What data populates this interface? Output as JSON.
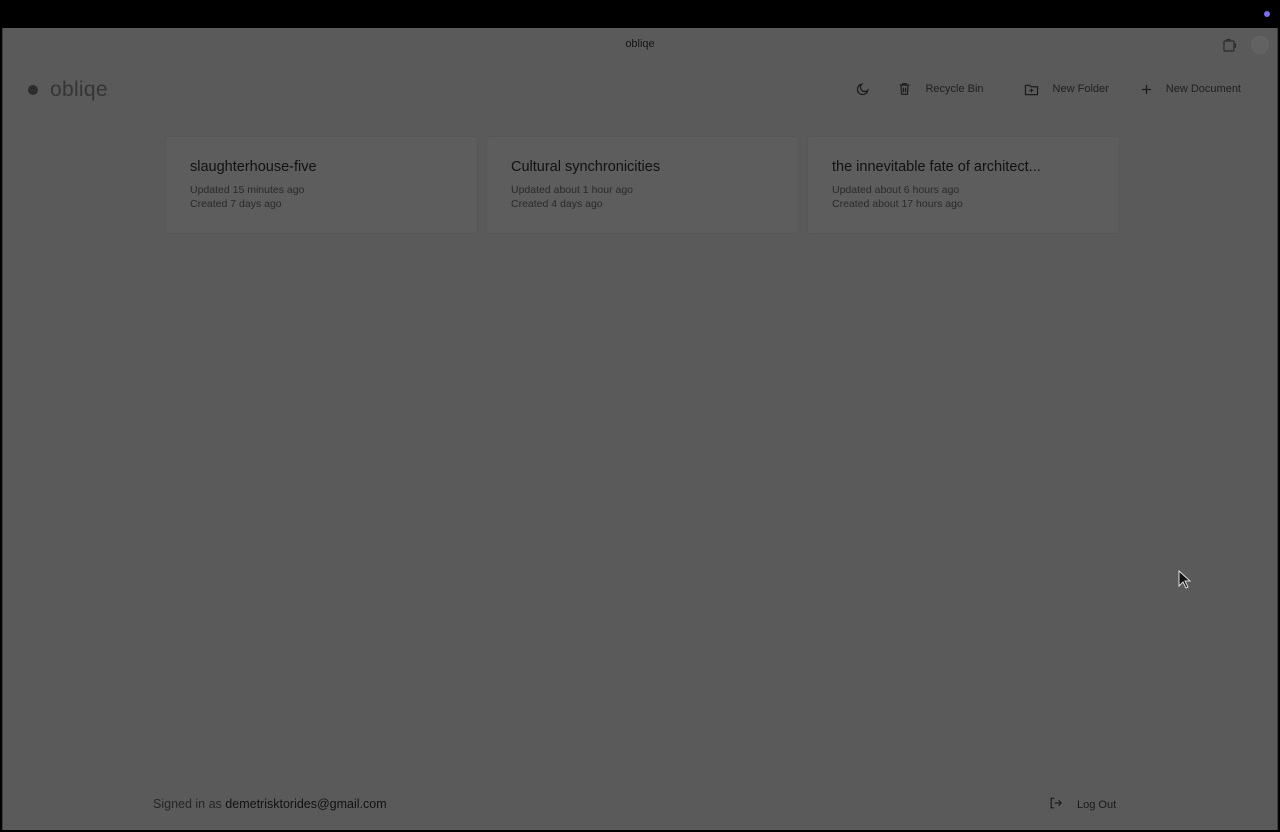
{
  "window": {
    "title": "obliqe"
  },
  "header": {
    "logo_text": "obliqe",
    "actions": {
      "theme_toggle_icon": "moon-icon",
      "recycle_bin_label": "Recycle Bin",
      "new_folder_label": "New Folder",
      "new_document_label": "New Document"
    }
  },
  "documents": [
    {
      "title": "slaughterhouse-five",
      "updated": "Updated 15 minutes ago",
      "created": "Created 7 days ago"
    },
    {
      "title": "Cultural synchronicities",
      "updated": "Updated about 1 hour ago",
      "created": "Created 4 days ago"
    },
    {
      "title": "the innevitable fate of architect...",
      "updated": "Updated about 6 hours ago",
      "created": "Created about 17 hours ago"
    }
  ],
  "footer": {
    "signed_in_prefix": "Signed in as",
    "email": "demetrisktorides@gmail.com",
    "logout_label": "Log Out"
  },
  "colors": {
    "overlay_background": "#5a5a5a",
    "accent_dot": "#7b6cf0"
  }
}
